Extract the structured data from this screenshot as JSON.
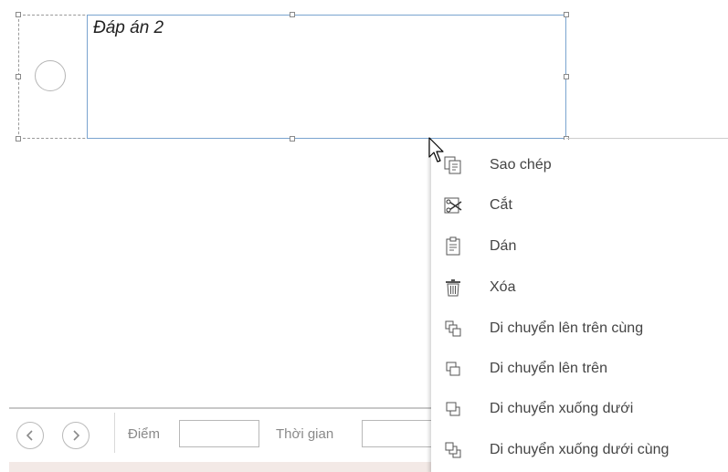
{
  "answer": {
    "label": "Đáp án 2"
  },
  "context_menu": {
    "items": [
      {
        "label": "Sao chép",
        "icon": "copy-icon"
      },
      {
        "label": "Cắt",
        "icon": "cut-icon"
      },
      {
        "label": "Dán",
        "icon": "paste-icon"
      },
      {
        "label": "Xóa",
        "icon": "delete-icon"
      },
      {
        "label": "Di chuyển lên trên cùng",
        "icon": "bring-to-front-icon"
      },
      {
        "label": "Di chuyển lên trên",
        "icon": "bring-forward-icon"
      },
      {
        "label": "Di chuyển xuống dưới",
        "icon": "send-backward-icon"
      },
      {
        "label": "Di chuyển xuống dưới cùng",
        "icon": "send-to-back-icon"
      }
    ]
  },
  "bottom_bar": {
    "prev_icon": "chevron-left-icon",
    "next_icon": "chevron-right-icon",
    "score_label": "Điểm",
    "score_value": "",
    "time_label": "Thời gian",
    "time_value": ""
  }
}
